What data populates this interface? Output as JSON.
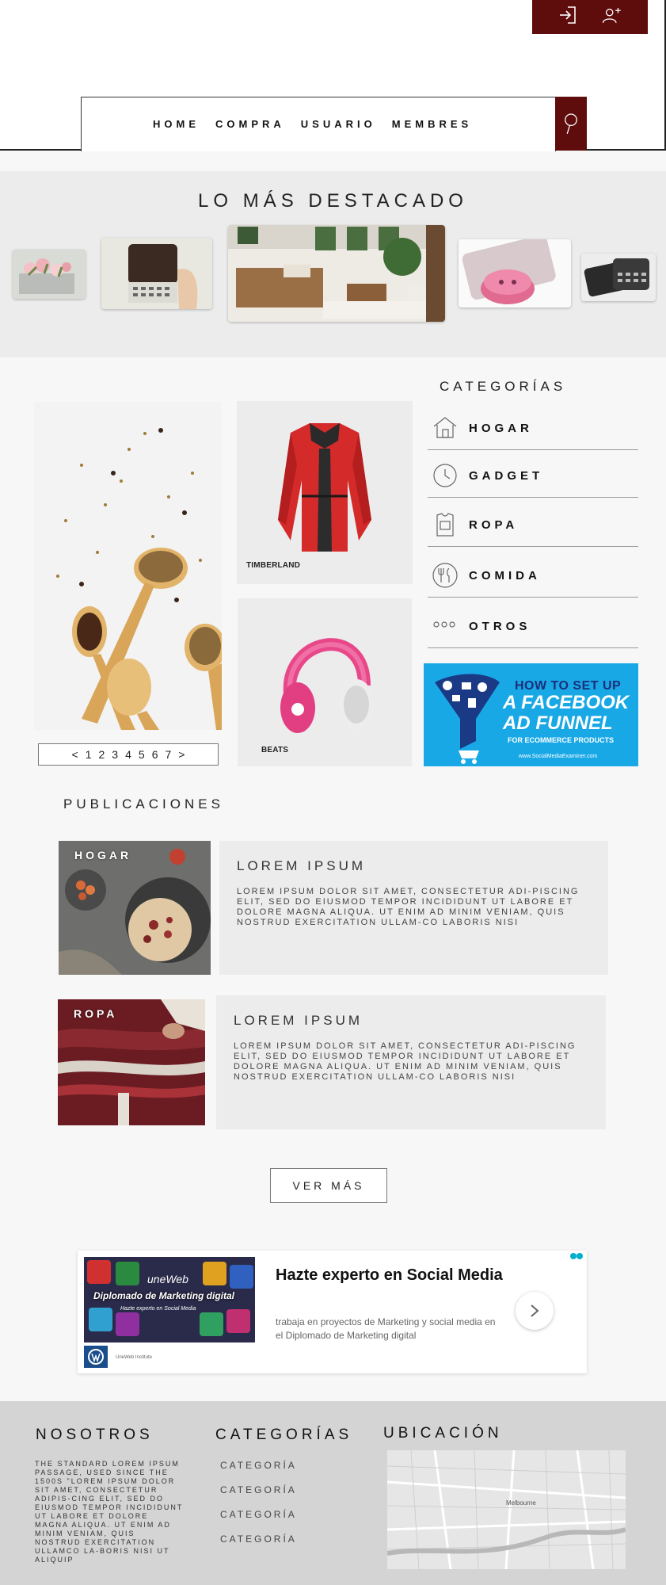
{
  "header": {
    "nav": [
      "HOME",
      "COMPRA",
      "USUARIO",
      "MEMBRES"
    ],
    "icons": [
      "login-icon",
      "add-user-icon",
      "search-icon"
    ]
  },
  "destacado": {
    "title": "LO MÁS DESTACADO"
  },
  "products": [
    {
      "name": "TIMBERLAND"
    },
    {
      "name": "BEATS"
    }
  ],
  "pager": [
    "<",
    "1",
    "2",
    "3",
    "4",
    "5",
    "6",
    "7",
    ">"
  ],
  "categories": {
    "title": "CATEGORÍAS",
    "items": [
      {
        "label": "HOGAR",
        "icon": "house-icon"
      },
      {
        "label": "GADGET",
        "icon": "clock-icon"
      },
      {
        "label": "ROPA",
        "icon": "shirt-icon"
      },
      {
        "label": "COMIDA",
        "icon": "cutlery-icon"
      },
      {
        "label": "OTROS",
        "icon": "dots-icon"
      }
    ]
  },
  "fb_ad": {
    "line1": "HOW TO SET UP",
    "line2": "A FACEBOOK",
    "line3": "AD FUNNEL",
    "line4": "FOR ECOMMERCE PRODUCTS",
    "line5": "www.SocialMediaExaminer.com"
  },
  "publicaciones": {
    "title": "PUBLICACIONES",
    "posts": [
      {
        "tag": "HOGAR",
        "title": "LOREM IPSUM",
        "body": "LOREM IPSUM DOLOR SIT AMET, CONSECTETUR ADI-PISCING ELIT, SED DO EIUSMOD TEMPOR INCIDIDUNT UT LABORE ET DOLORE MAGNA ALIQUA. UT ENIM AD MINIM VENIAM, QUIS NOSTRUD EXERCITATION ULLAM-CO LABORIS NISI"
      },
      {
        "tag": "ROPA",
        "title": "LOREM IPSUM",
        "body": "LOREM IPSUM DOLOR SIT AMET, CONSECTETUR ADI-PISCING ELIT, SED DO EIUSMOD TEMPOR INCIDIDUNT UT LABORE ET DOLORE MAGNA ALIQUA. UT ENIM AD MINIM VENIAM, QUIS NOSTRUD EXERCITATION ULLAM-CO LABORIS NISI"
      }
    ],
    "more_label": "VER MÁS"
  },
  "ad": {
    "image_brand": "uneWeb",
    "image_title": "Diplomado de Marketing digital",
    "image_sub": "Hazte experto en Social Media",
    "institute": "UneWeb Institute",
    "headline": "Hazte experto en Social Media",
    "body": "trabaja en proyectos de Marketing y social media en el Diplomado de Marketing digital"
  },
  "footer": {
    "about_title": "NOSOTROS",
    "about_text": "THE STANDARD LOREM IPSUM PASSAGE, USED SINCE THE 1500S \"LOREM IPSUM DOLOR SIT AMET, CONSECTETUR ADIPIS-CING ELIT, SED DO EIUSMOD TEMPOR INCIDIDUNT UT LABORE ET DOLORE MAGNA ALIQUA. UT ENIM AD MINIM VENIAM, QUIS NOSTRUD EXERCITATION ULLAMCO LA-BORIS NISI UT ALIQUIP",
    "cat_title": "CATEGORÍAS",
    "cat_items": [
      "CATEGORÍA",
      "CATEGORÍA",
      "CATEGORÍA",
      "CATEGORÍA"
    ],
    "loc_title": "UBICACIÓN",
    "map_label": "Melbourne"
  }
}
